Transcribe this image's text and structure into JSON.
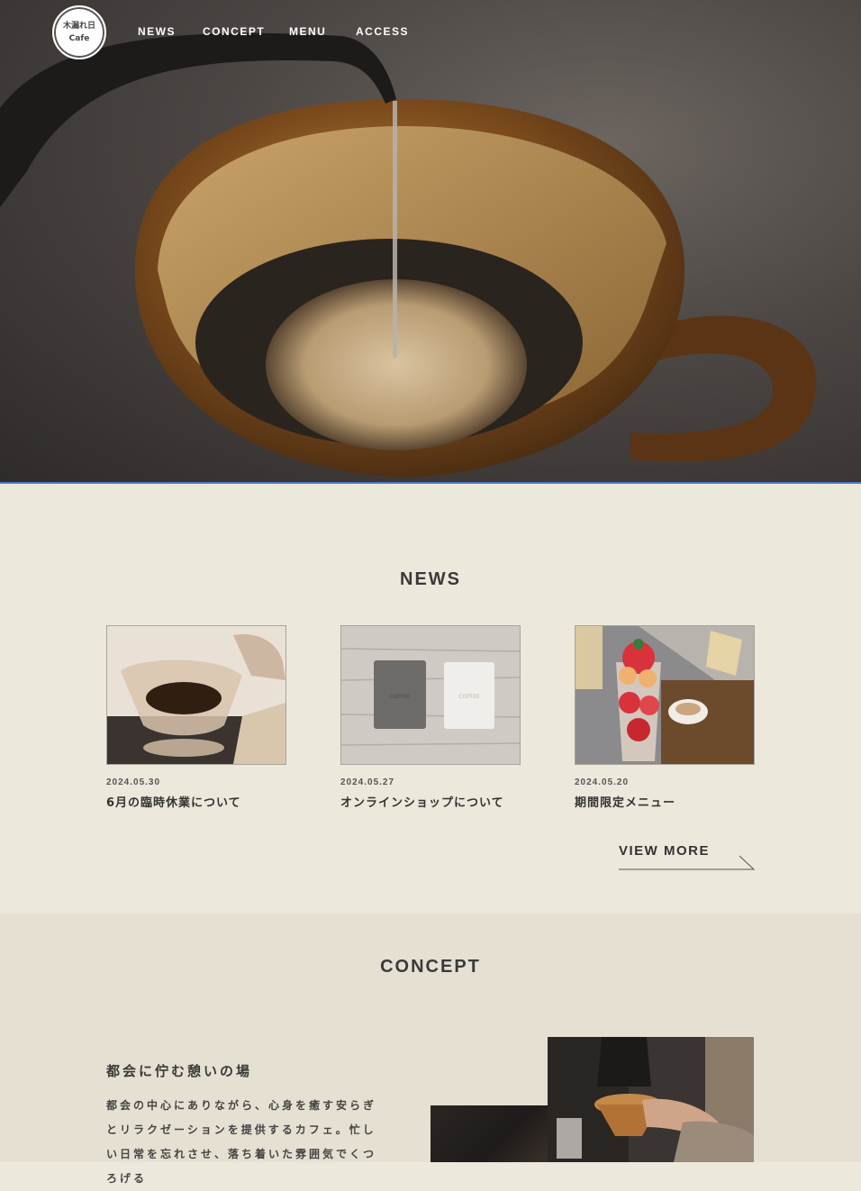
{
  "header": {
    "logo_line1": "木漏れ日",
    "logo_line2": "Cafe",
    "nav": [
      "NEWS",
      "CONCEPT",
      "MENU",
      "ACCESS"
    ]
  },
  "news": {
    "title": "NEWS",
    "items": [
      {
        "date": "2024.05.30",
        "title": "6月の臨時休業について"
      },
      {
        "date": "2024.05.27",
        "title": "オンラインショップについて"
      },
      {
        "date": "2024.05.20",
        "title": "期間限定メニュー"
      }
    ],
    "view_more": "VIEW MORE"
  },
  "concept": {
    "title": "CONCEPT",
    "heading": "都会に佇む憩いの場",
    "body": "都会の中心にありながら、心身を癒す安らぎとリラクゼーションを提供するカフェ。忙しい日常を忘れさせ、落ち着いた雰囲気でくつろげる"
  },
  "colors": {
    "background": "#ede8dc",
    "concept_background": "#e6e0d3",
    "text": "#3b3b3b",
    "hero_divider": "#4a79c7"
  }
}
